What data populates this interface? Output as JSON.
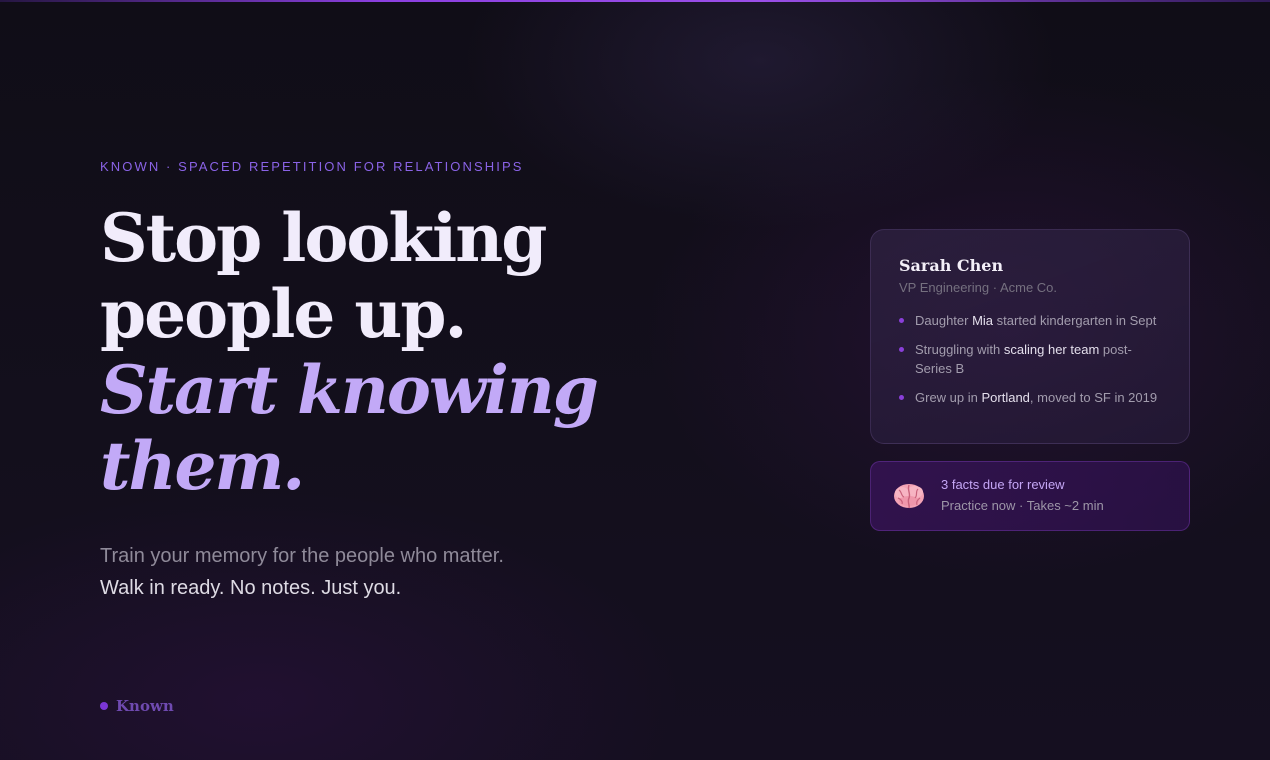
{
  "hero": {
    "eyebrow": "KNOWN · SPACED REPETITION FOR RELATIONSHIPS",
    "headline": {
      "line1": "Stop looking",
      "line2": "people up.",
      "line3": "Start knowing",
      "line4": "them."
    },
    "subtitle_line1": "Train your memory for the people who matter.",
    "subtitle_line2": "Walk in ready. No notes. Just you."
  },
  "brand": {
    "name": "Known"
  },
  "contact_card": {
    "name": "Sarah Chen",
    "role": "VP Engineering · Acme Co.",
    "facts": [
      {
        "before": "Daughter ",
        "highlight": "Mia",
        "after": " started kindergarten in Sept"
      },
      {
        "before": "Struggling with ",
        "highlight": "scaling her team",
        "after": " post-Series B"
      },
      {
        "before": "Grew up in ",
        "highlight": "Portland",
        "after": ", moved to SF in 2019"
      }
    ]
  },
  "review_banner": {
    "icon": "brain-icon",
    "title": "3 facts due for review",
    "subtitle": "Practice now · Takes ~2 min"
  },
  "colors": {
    "accent": "#8b3fe0",
    "headline_accent": "#c2a9f7",
    "background": "#110d18"
  }
}
